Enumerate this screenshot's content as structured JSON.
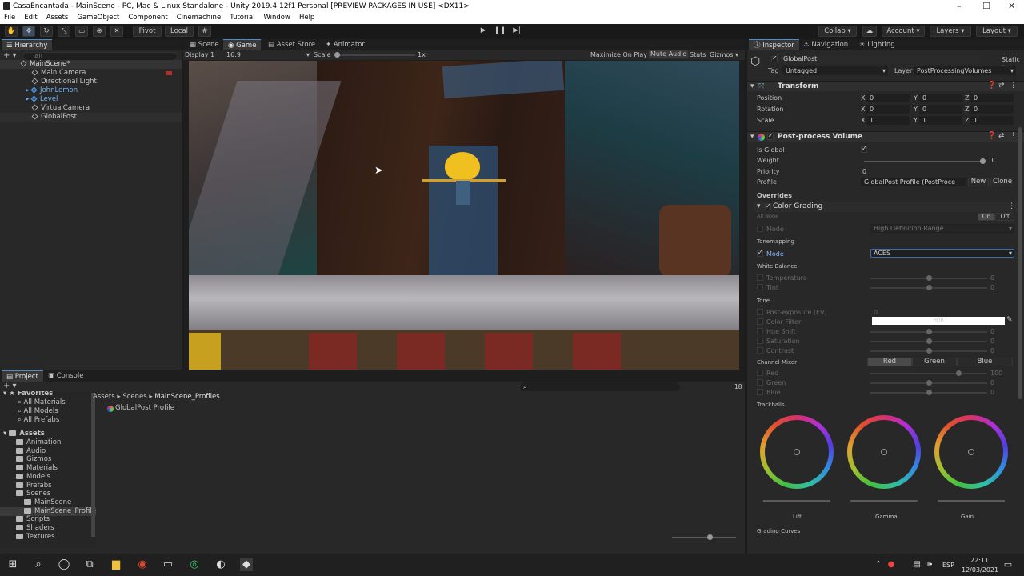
{
  "window": {
    "title": "CasaEncantada - MainScene - PC, Mac & Linux Standalone - Unity 2019.4.12f1 Personal [PREVIEW PACKAGES IN USE] <DX11>"
  },
  "menu": [
    "File",
    "Edit",
    "Assets",
    "GameObject",
    "Component",
    "Cinemachine",
    "Tutorial",
    "Window",
    "Help"
  ],
  "toolbar": {
    "pivot": "Pivot",
    "local": "Local",
    "collab": "Collab",
    "account": "Account",
    "layers": "Layers",
    "layout": "Layout"
  },
  "hierarchy": {
    "tab": "Hierarchy",
    "search_placeholder": "All",
    "scene": "MainScene*",
    "items": [
      "Main Camera",
      "Directional Light",
      "JohnLemon",
      "Level",
      "VirtualCamera",
      "GlobalPost"
    ]
  },
  "view_tabs": [
    "Scene",
    "Game",
    "Asset Store",
    "Animator"
  ],
  "game_bar": {
    "display": "Display 1",
    "aspect": "16:9",
    "scale_label": "Scale",
    "scale_value": "1x",
    "options": [
      "Maximize On Play",
      "Mute Audio",
      "Stats",
      "Gizmos"
    ]
  },
  "project": {
    "tabs": [
      "Project",
      "Console"
    ],
    "breadcrumb": [
      "Assets",
      "Scenes",
      "MainScene_Profiles"
    ],
    "file": "GlobalPost Profile",
    "count": "18",
    "favorites_label": "Favorites",
    "favorites": [
      "All Materials",
      "All Models",
      "All Prefabs"
    ],
    "assets_label": "Assets",
    "folders": [
      "Animation",
      "Audio",
      "Gizmos",
      "Materials",
      "Models",
      "Prefabs",
      "Scenes"
    ],
    "scene_subfolders": [
      "MainScene",
      "MainScene_Profiles"
    ],
    "more_folders": [
      "Scripts",
      "Shaders",
      "Textures"
    ]
  },
  "inspector": {
    "tabs": [
      "Inspector",
      "Navigation",
      "Lighting"
    ],
    "object_name": "GlobalPost",
    "static_label": "Static",
    "tag_label": "Tag",
    "tag_value": "Untagged",
    "layer_label": "Layer",
    "layer_value": "PostProcessingVolumes",
    "transform": {
      "title": "Transform",
      "rows": [
        {
          "label": "Position",
          "x": "0",
          "y": "0",
          "z": "0"
        },
        {
          "label": "Rotation",
          "x": "0",
          "y": "0",
          "z": "0"
        },
        {
          "label": "Scale",
          "x": "1",
          "y": "1",
          "z": "1"
        }
      ]
    },
    "volume": {
      "title": "Post-process Volume",
      "is_global_label": "Is Global",
      "weight_label": "Weight",
      "weight_value": "1",
      "priority_label": "Priority",
      "priority_value": "0",
      "profile_label": "Profile",
      "profile_value": "GlobalPost Profile (PostProce",
      "new_label": "New",
      "clone_label": "Clone"
    },
    "overrides_label": "Overrides",
    "color_grading": {
      "title": "Color Grading",
      "all_none": "All  None",
      "on": "On",
      "off": "Off",
      "mode_label": "Mode",
      "mode_value": "High Definition Range",
      "tonemapping_label": "Tonemapping",
      "tm_mode_label": "Mode",
      "tm_mode_value": "ACES",
      "white_balance_label": "White Balance",
      "temperature_label": "Temperature",
      "temperature_value": "0",
      "tint_label": "Tint",
      "tint_value": "0",
      "tone_label": "Tone",
      "post_exposure_label": "Post-exposure (EV)",
      "post_exposure_value": "0",
      "color_filter_label": "Color Filter",
      "color_filter_hdr": "HDR",
      "hue_shift_label": "Hue Shift",
      "hue_shift_value": "0",
      "saturation_label": "Saturation",
      "saturation_value": "0",
      "contrast_label": "Contrast",
      "contrast_value": "0",
      "channel_mixer_label": "Channel Mixer",
      "channels": [
        "Red",
        "Green",
        "Blue"
      ],
      "red_label": "Red",
      "red_value": "100",
      "green_label": "Green",
      "green_value": "0",
      "blue_label": "Blue",
      "blue_value": "0",
      "trackballs_label": "Trackballs",
      "wheels": [
        "Lift",
        "Gamma",
        "Gain"
      ],
      "grading_curves_label": "Grading Curves"
    }
  },
  "taskbar": {
    "lang": "ESP",
    "time": "22:11",
    "date": "12/03/2021"
  }
}
